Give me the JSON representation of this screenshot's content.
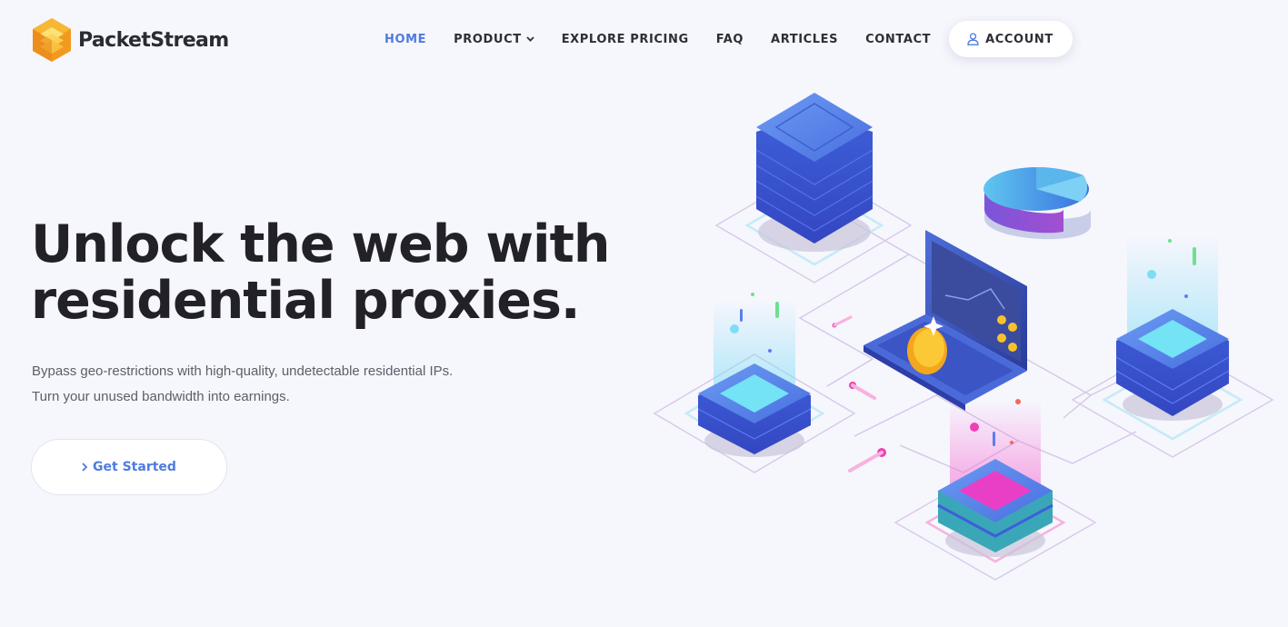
{
  "brand": {
    "name": "PacketStream",
    "logo_icon": "stacked-layers-logo"
  },
  "nav": {
    "items": [
      {
        "label": "HOME",
        "active": true
      },
      {
        "label": "PRODUCT",
        "has_dropdown": true
      },
      {
        "label": "EXPLORE PRICING"
      },
      {
        "label": "FAQ"
      },
      {
        "label": "ARTICLES"
      },
      {
        "label": "CONTACT"
      }
    ],
    "account": {
      "label": "ACCOUNT",
      "icon": "user-icon"
    }
  },
  "hero": {
    "title_line1": "Unlock the web with",
    "title_line2": "residential proxies.",
    "subtitle_line1": "Bypass geo-restrictions with high-quality, undetectable residential IPs.",
    "subtitle_line2": "Turn your unused bandwidth into earnings.",
    "cta_label": "Get Started"
  },
  "colors": {
    "accent": "#4e7be0",
    "background": "#f6f6fd",
    "text": "#212127",
    "logo_orange": "#f5a623"
  }
}
